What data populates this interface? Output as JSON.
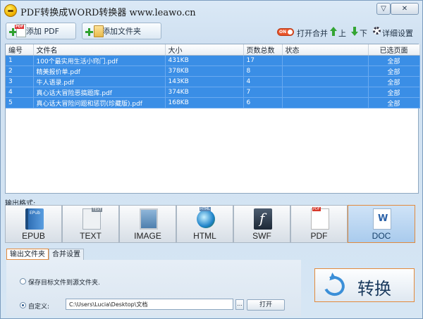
{
  "window": {
    "title": "PDF转换成WORD转换器 www.leawo.cn",
    "minimize_icon": "chevron-down-icon",
    "close_icon": "close-icon"
  },
  "toolbar": {
    "add_pdf_label": "添加 PDF",
    "add_folder_label": "添加文件夹",
    "toggle_text": "ON",
    "merge_label": "打开合并",
    "up_label": "上",
    "down_label": "下",
    "settings_label": "详细设置"
  },
  "table": {
    "headers": [
      "编号",
      "文件名",
      "大小",
      "页数总数",
      "状态",
      "已选页面"
    ],
    "rows": [
      {
        "index": "1",
        "name": "100个最实用生活小窍门.pdf",
        "size": "431KB",
        "pages": "17",
        "status": "",
        "selected": "全部"
      },
      {
        "index": "2",
        "name": "精美报价单.pdf",
        "size": "378KB",
        "pages": "8",
        "status": "",
        "selected": "全部"
      },
      {
        "index": "3",
        "name": "牛人语录.pdf",
        "size": "143KB",
        "pages": "4",
        "status": "",
        "selected": "全部"
      },
      {
        "index": "4",
        "name": "真心话大冒险恶搞题库.pdf",
        "size": "374KB",
        "pages": "7",
        "status": "",
        "selected": "全部"
      },
      {
        "index": "5",
        "name": "真心话大冒险问题和惩罚(珍藏版).pdf",
        "size": "168KB",
        "pages": "6",
        "status": "",
        "selected": "全部"
      }
    ]
  },
  "formats": {
    "label": "输出格式:",
    "items": [
      {
        "label": "EPUB",
        "icon": "epub-icon"
      },
      {
        "label": "TEXT",
        "icon": "text-icon"
      },
      {
        "label": "IMAGE",
        "icon": "image-icon"
      },
      {
        "label": "HTML",
        "icon": "html-globe-icon"
      },
      {
        "label": "SWF",
        "icon": "swf-flash-icon"
      },
      {
        "label": "PDF",
        "icon": "pdf-icon"
      },
      {
        "label": "DOC",
        "icon": "word-doc-icon"
      }
    ],
    "selected": "DOC"
  },
  "output": {
    "tabs": [
      "输出文件夹",
      "合并设置"
    ],
    "keep_source_label": "保存目标文件到源文件夹.",
    "custom_label": "自定义:",
    "path_value": "C:\\Users\\Lucia\\Desktop\\文档",
    "browse_label": "...",
    "open_label": "打开"
  },
  "convert": {
    "label": "转换"
  },
  "colors": {
    "selection_blue": "#3a8ee6",
    "active_orange": "#e28a3c",
    "toggle_red": "#e8542a",
    "arrow_green": "#34a534"
  }
}
